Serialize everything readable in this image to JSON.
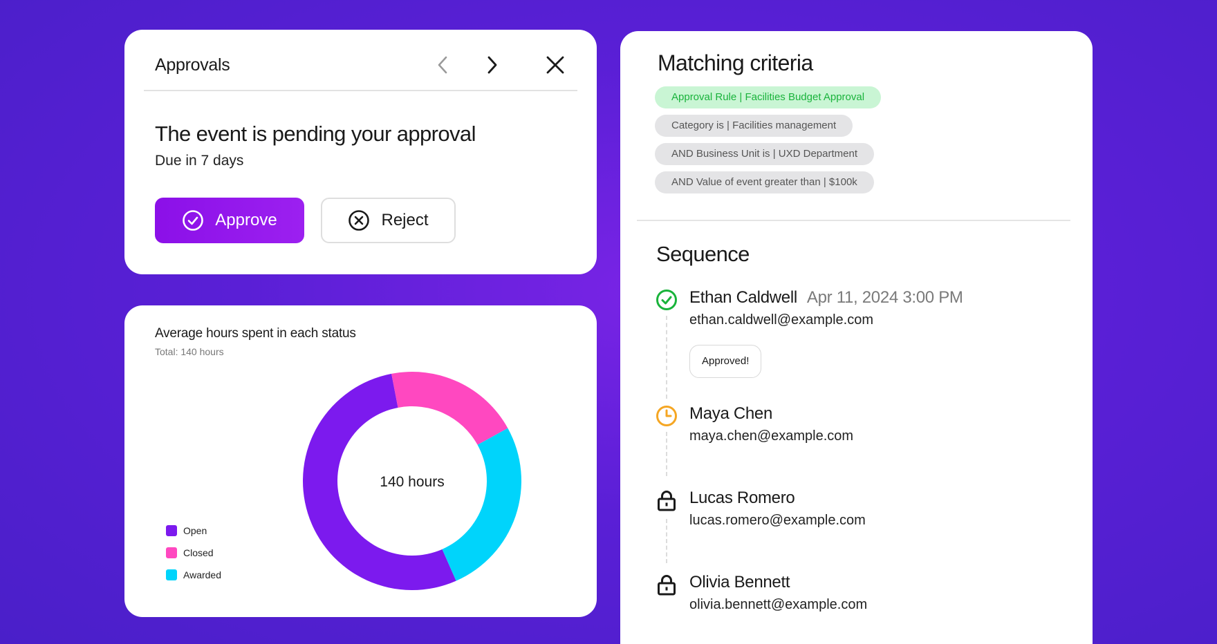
{
  "approvals": {
    "title": "Approvals",
    "heading": "The event is pending your approval",
    "due": "Due in 7 days",
    "approve_label": "Approve",
    "reject_label": "Reject"
  },
  "chart_data": {
    "type": "pie",
    "title": "Average hours spent in each status",
    "subtitle": "Total: 140 hours",
    "center_label": "140 hours",
    "categories": [
      "Open",
      "Closed",
      "Awarded"
    ],
    "values": [
      75,
      28,
      37
    ],
    "colors": [
      "#7c1aee",
      "#ff48c0",
      "#00d4fb"
    ],
    "legend_position": "bottom-left"
  },
  "matching": {
    "title": "Matching criteria",
    "chips": [
      {
        "label": "Approval Rule | Facilities Budget Approval",
        "style": "green"
      },
      {
        "label": "Category is | Facilities management",
        "style": "gray"
      },
      {
        "label": "AND Business Unit is | UXD Department",
        "style": "gray"
      },
      {
        "label": "AND Value of event greater than | $100k",
        "style": "gray"
      }
    ]
  },
  "sequence": {
    "title": "Sequence",
    "steps": [
      {
        "name": "Ethan Caldwell",
        "date": "Apr 11, 2024 3:00 PM",
        "email": "ethan.caldwell@example.com",
        "status": "approved",
        "comment": "Approved!"
      },
      {
        "name": "Maya Chen",
        "email": "maya.chen@example.com",
        "status": "pending"
      },
      {
        "name": "Lucas Romero",
        "email": "lucas.romero@example.com",
        "status": "locked"
      },
      {
        "name": "Olivia Bennett",
        "email": "olivia.bennett@example.com",
        "status": "locked"
      }
    ]
  },
  "colors": {
    "accent": "#8b10e8",
    "approved": "#19b33b",
    "pending": "#f5a623",
    "chip_green_bg": "#c9f5d4",
    "chip_gray_bg": "#e4e4e6"
  }
}
